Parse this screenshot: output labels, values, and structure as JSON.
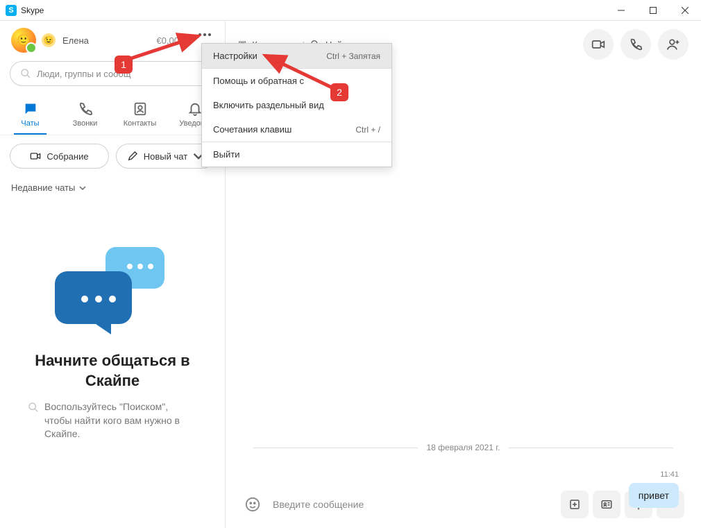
{
  "titlebar": {
    "app_name": "Skype"
  },
  "profile": {
    "name": "Елена",
    "balance": "€0,00"
  },
  "search": {
    "placeholder": "Люди, группы и сообщ"
  },
  "tabs": {
    "chats": "Чаты",
    "calls": "Звонки",
    "contacts": "Контакты",
    "notifications": "Уведомл"
  },
  "actions": {
    "meeting": "Собрание",
    "new_chat": "Новый чат"
  },
  "recent_header": "Недавние чаты",
  "empty": {
    "title": "Начните общаться в Скайпе",
    "desc": "Воспользуйтесь \"Поиском\", чтобы найти кого вам нужно в Скайпе."
  },
  "chat_header": {
    "collection": "Коллекция",
    "find": "Найти"
  },
  "menu": {
    "settings": {
      "label": "Настройки",
      "shortcut": "Ctrl + Запятая"
    },
    "help": "Помощь и обратная с",
    "split": "Включить раздельный вид",
    "shortcuts": {
      "label": "Сочетания клавиш",
      "shortcut": "Ctrl + /"
    },
    "exit": "Выйти"
  },
  "conversation": {
    "date": "18 февраля 2021 г.",
    "time": "11:41",
    "message": "привет"
  },
  "composer": {
    "placeholder": "Введите сообщение"
  },
  "annotations": {
    "one": "1",
    "two": "2"
  }
}
